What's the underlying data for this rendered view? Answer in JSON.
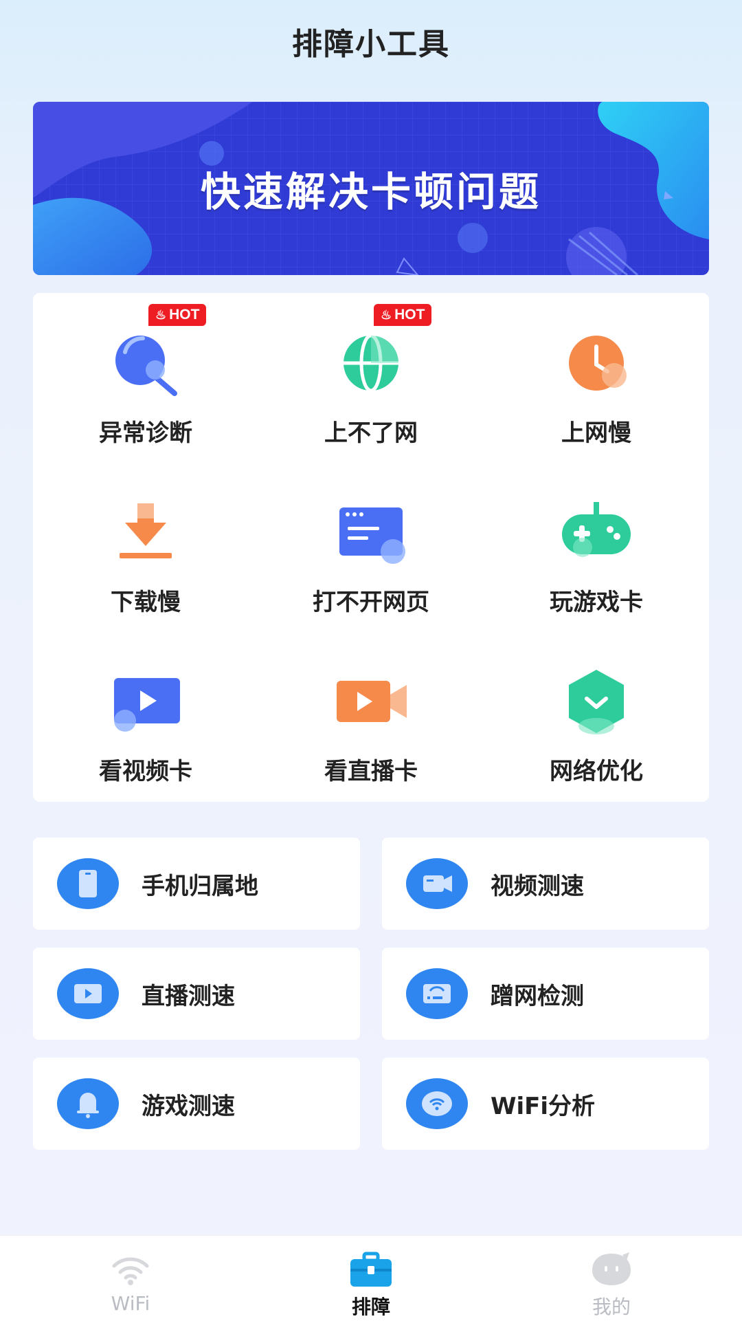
{
  "header": {
    "title": "排障小工具"
  },
  "banner": {
    "text": "快速解决卡顿问题"
  },
  "hot_badge_label": "HOT",
  "grid": [
    {
      "label": "异常诊断",
      "icon": "diagnosis-icon",
      "hot": true
    },
    {
      "label": "上不了网",
      "icon": "globe-icon",
      "hot": true
    },
    {
      "label": "上网慢",
      "icon": "clock-icon",
      "hot": false
    },
    {
      "label": "下载慢",
      "icon": "download-icon",
      "hot": false
    },
    {
      "label": "打不开网页",
      "icon": "webpage-icon",
      "hot": false
    },
    {
      "label": "玩游戏卡",
      "icon": "gamepad-icon",
      "hot": false
    },
    {
      "label": "看视频卡",
      "icon": "video-play-icon",
      "hot": false
    },
    {
      "label": "看直播卡",
      "icon": "live-camera-icon",
      "hot": false
    },
    {
      "label": "网络优化",
      "icon": "shield-optimize-icon",
      "hot": false
    }
  ],
  "tools": [
    {
      "label": "手机归属地",
      "icon": "phone-icon"
    },
    {
      "label": "视频测速",
      "icon": "video-camera-icon"
    },
    {
      "label": "直播测速",
      "icon": "live-play-icon"
    },
    {
      "label": "蹭网检测",
      "icon": "router-icon"
    },
    {
      "label": "游戏测速",
      "icon": "game-bell-icon"
    },
    {
      "label": "WiFi分析",
      "icon": "wifi-icon"
    }
  ],
  "nav": {
    "wifi": "WiFi",
    "troubleshoot": "排障",
    "mine": "我的",
    "active": "troubleshoot"
  },
  "colors": {
    "banner": "#2f3bd4",
    "hot": "#ee1c23",
    "blue_icon": "#4a6ff5",
    "green_icon": "#2ecc9a",
    "orange_icon": "#f58a4b",
    "nav_active": "#1aa3e8"
  }
}
